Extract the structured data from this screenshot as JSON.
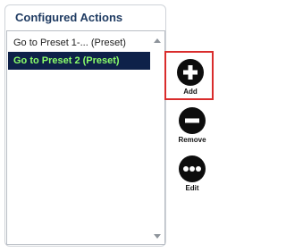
{
  "panel": {
    "title": "Configured Actions",
    "items": [
      {
        "label": "Go to Preset 1-... (Preset)",
        "selected": false
      },
      {
        "label": "Go to Preset 2 (Preset)",
        "selected": true
      }
    ]
  },
  "actions": {
    "add_label": "Add",
    "remove_label": "Remove",
    "edit_label": "Edit"
  },
  "icons": {
    "add": "plus-circle-icon",
    "remove": "minus-circle-icon",
    "edit": "more-horizontal-icon",
    "scroll_up": "chevron-up-icon",
    "scroll_down": "chevron-down-icon"
  },
  "colors": {
    "title": "#1f3b62",
    "selected_bg": "#0e2149",
    "selected_text": "#8bff6a",
    "highlight_border": "#d92c2c",
    "icon_fill": "#0d0d0d"
  }
}
